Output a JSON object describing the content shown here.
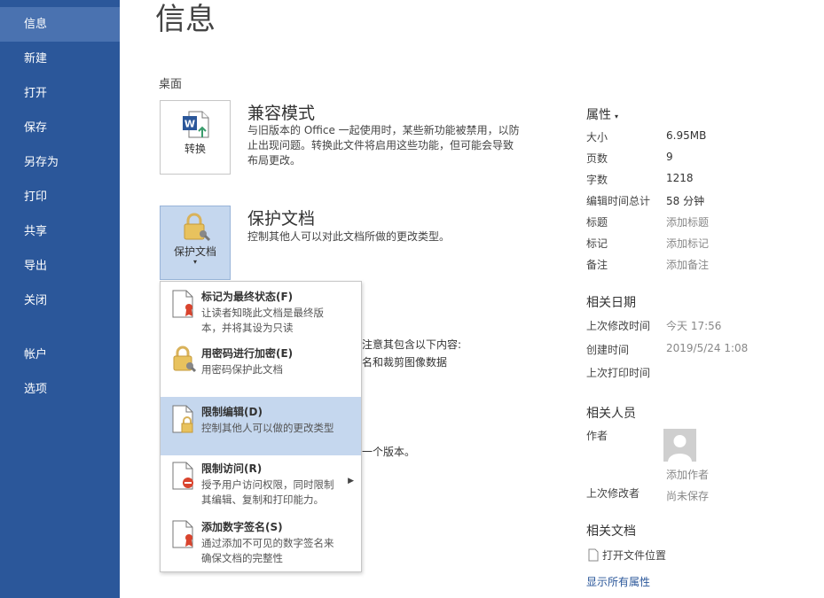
{
  "sidebar": {
    "items": [
      {
        "label": "信息",
        "active": true
      },
      {
        "label": "新建"
      },
      {
        "label": "打开"
      },
      {
        "label": "保存"
      },
      {
        "label": "另存为"
      },
      {
        "label": "打印"
      },
      {
        "label": "共享"
      },
      {
        "label": "导出"
      },
      {
        "label": "关闭"
      },
      {
        "label": "帐户"
      },
      {
        "label": "选项"
      }
    ]
  },
  "main": {
    "title": "信息",
    "location": "桌面",
    "compat": {
      "button_label": "转换",
      "title": "兼容模式",
      "desc_lines": [
        "与旧版本的 Office 一起使用时，某些新功能被禁用，以防",
        "止出现问题。转换此文件将启用这些功能，但可能会导致",
        "布局更改。"
      ]
    },
    "protect": {
      "button_label": "保护文档",
      "title": "保护文档",
      "desc": "控制其他人可以对此文档所做的更改类型。"
    },
    "background_fragments": {
      "line1": "注意其包含以下内容:",
      "line2": "名和裁剪图像数据",
      "line3": "一个版本。"
    }
  },
  "dropdown": {
    "items": [
      {
        "title": "标记为最终状态(F)",
        "desc_lines": [
          "让读者知晓此文档是最终版",
          "本，并将其设为只读"
        ]
      },
      {
        "title": "用密码进行加密(E)",
        "desc_lines": [
          "用密码保护此文档"
        ]
      },
      {
        "title": "限制编辑(D)",
        "desc_lines": [
          "控制其他人可以做的更改类型"
        ],
        "hover": true
      },
      {
        "title": "限制访问(R)",
        "desc_lines": [
          "授予用户访问权限，同时限制",
          "其编辑、复制和打印能力。"
        ],
        "has_submenu": true
      },
      {
        "title": "添加数字签名(S)",
        "desc_lines": [
          "通过添加不可见的数字签名来",
          "确保文档的完整性"
        ]
      }
    ]
  },
  "properties": {
    "header": "属性",
    "rows": [
      {
        "label": "大小",
        "value": "6.95MB",
        "muted": false
      },
      {
        "label": "页数",
        "value": "9",
        "muted": false
      },
      {
        "label": "字数",
        "value": "1218",
        "muted": false
      },
      {
        "label": "编辑时间总计",
        "value": "58 分钟",
        "muted": false
      },
      {
        "label": "标题",
        "value": "添加标题",
        "muted": true
      },
      {
        "label": "标记",
        "value": "添加标记",
        "muted": true
      },
      {
        "label": "备注",
        "value": "添加备注",
        "muted": true
      }
    ]
  },
  "related_dates": {
    "title": "相关日期",
    "rows": [
      {
        "label": "上次修改时间",
        "value": "今天 17:56"
      },
      {
        "label": "创建时间",
        "value": "2019/5/24 1:08"
      },
      {
        "label": "上次打印时间",
        "value": ""
      }
    ]
  },
  "related_people": {
    "title": "相关人员",
    "author_label": "作者",
    "add_author": "添加作者",
    "last_modified_by_label": "上次修改者",
    "last_modified_by_value": "尚未保存"
  },
  "related_docs": {
    "title": "相关文档",
    "open_location": "打开文件位置",
    "show_all": "显示所有属性"
  },
  "colors": {
    "sidebar": "#2b579a",
    "sidebar_active": "#4a72b0",
    "hover": "#c5d7ee",
    "link": "#2b579a"
  }
}
